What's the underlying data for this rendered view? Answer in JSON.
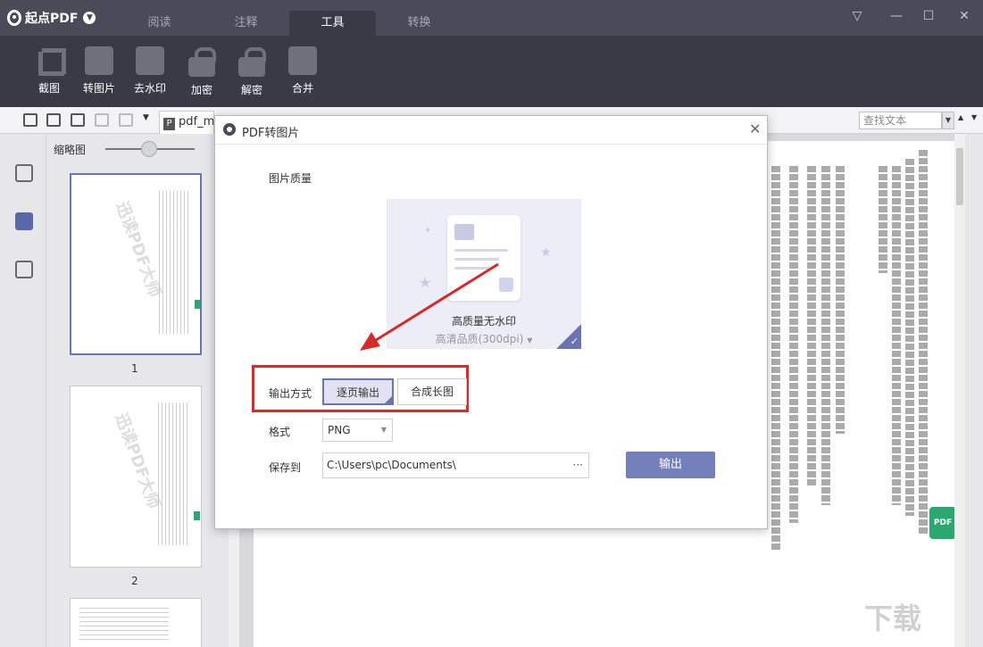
{
  "app": {
    "name": "起点PDF"
  },
  "tabs": [
    {
      "label": "阅读"
    },
    {
      "label": "注释"
    },
    {
      "label": "工具",
      "active": true
    },
    {
      "label": "转换"
    }
  ],
  "window_controls": {
    "menu": "▽",
    "minimize": "—",
    "maximize": "☐",
    "close": "✕"
  },
  "tools": [
    {
      "label": "截图",
      "icon": "crop-icon"
    },
    {
      "label": "转图片",
      "icon": "image-icon"
    },
    {
      "label": "去水印",
      "icon": "watermark-icon"
    },
    {
      "label": "加密",
      "icon": "lock-icon"
    },
    {
      "label": "解密",
      "icon": "unlock-icon"
    },
    {
      "label": "合并",
      "icon": "merge-icon"
    }
  ],
  "document_tab": {
    "title": "pdf_me"
  },
  "search": {
    "placeholder": "查找文本"
  },
  "thumbnails": {
    "header": "缩略图",
    "pages": [
      {
        "number": "1"
      },
      {
        "number": "2"
      }
    ],
    "watermark_text": "迅读PDF大师"
  },
  "dialog": {
    "title": "PDF转图片",
    "quality_label": "图片质量",
    "quality_card": {
      "title": "高质量无水印",
      "subtitle": "高清品质(300dpi)"
    },
    "output_mode_label": "输出方式",
    "output_modes": [
      {
        "label": "逐页输出",
        "selected": true
      },
      {
        "label": "合成长图",
        "selected": false
      }
    ],
    "format_label": "格式",
    "format_value": "PNG",
    "save_label": "保存到",
    "save_path": "C:\\Users\\pc\\Documents\\",
    "output_button": "输出"
  },
  "badge": {
    "text": "PDF"
  },
  "colors": {
    "titlebar": "#4a4a58",
    "toolbar": "#3a3a46",
    "accent": "#6b74b0",
    "highlight": "#d62b2b",
    "badge": "#2aa86f"
  }
}
